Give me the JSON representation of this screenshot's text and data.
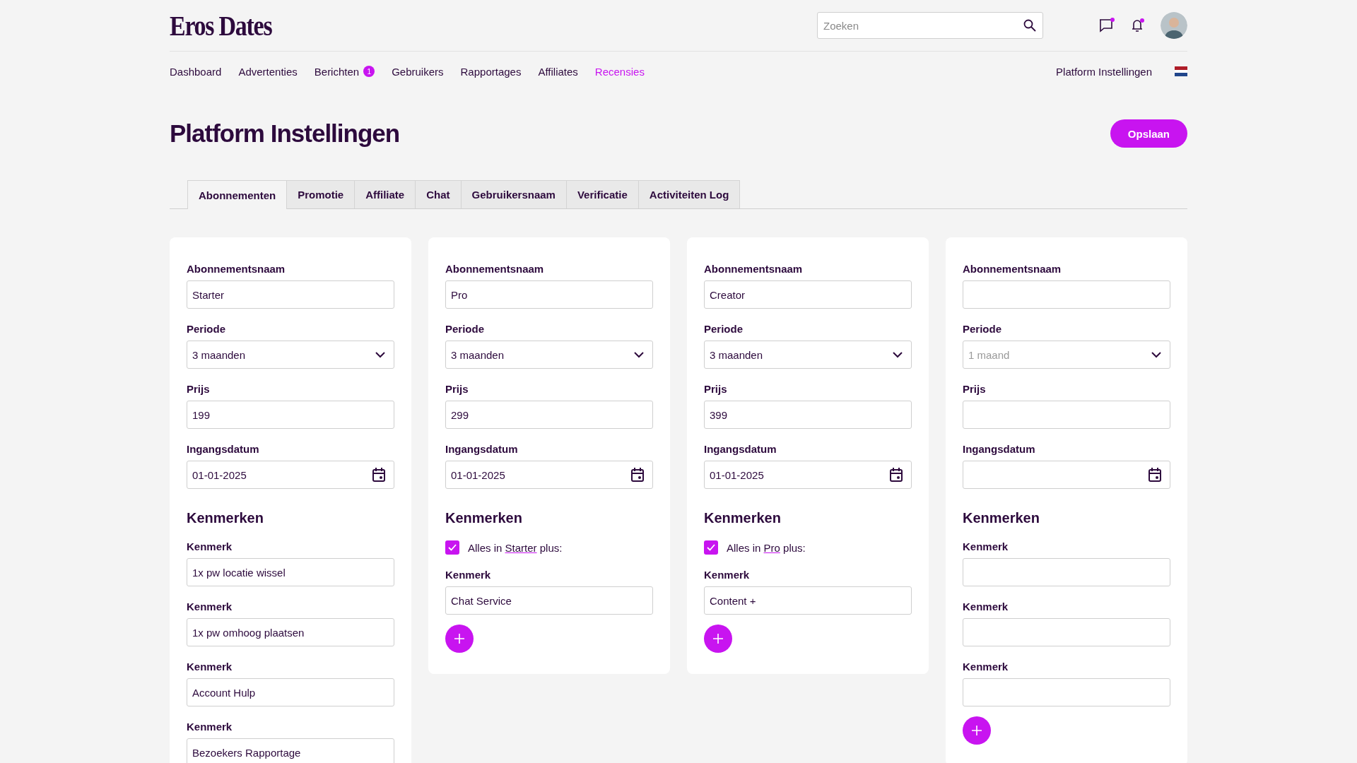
{
  "header": {
    "logo": "Eros Dates",
    "search": {
      "placeholder": "Zoeken"
    }
  },
  "nav": {
    "items": [
      {
        "label": "Dashboard",
        "selected": false
      },
      {
        "label": "Advertenties",
        "selected": false
      },
      {
        "label": "Berichten",
        "selected": false,
        "badge": "1"
      },
      {
        "label": "Gebruikers",
        "selected": false
      },
      {
        "label": "Rapportages",
        "selected": false
      },
      {
        "label": "Affiliates",
        "selected": false
      },
      {
        "label": "Recensies",
        "selected": true
      }
    ],
    "settings_link": "Platform Instellingen"
  },
  "page": {
    "title": "Platform Instellingen",
    "save_button": "Opslaan"
  },
  "tabs": [
    {
      "label": "Abonnementen",
      "selected": true
    },
    {
      "label": "Promotie",
      "selected": false
    },
    {
      "label": "Affiliate",
      "selected": false
    },
    {
      "label": "Chat",
      "selected": false
    },
    {
      "label": "Gebruikersnaam",
      "selected": false
    },
    {
      "label": "Verificatie",
      "selected": false
    },
    {
      "label": "Activiteiten Log",
      "selected": false
    }
  ],
  "plans": [
    {
      "name_label": "Abonnementsnaam",
      "name": "Starter",
      "period_label": "Periode",
      "period": {
        "value": "3 maanden"
      },
      "price_label": "Prijs",
      "price": "199",
      "date_label": "Ingangsdatum",
      "date": "01-01-2025",
      "features_heading": "Kenmerken",
      "features": [
        {
          "label": "Kenmerk",
          "value": "1x pw locatie wissel"
        },
        {
          "label": "Kenmerk",
          "value": "1x pw omhoog plaatsen"
        },
        {
          "label": "Kenmerk",
          "value": "Account Hulp"
        },
        {
          "label": "Kenmerk",
          "value": "Bezoekers Rapportage"
        }
      ]
    },
    {
      "name_label": "Abonnementsnaam",
      "name": "Pro",
      "period_label": "Periode",
      "period": {
        "value": "3 maanden"
      },
      "price_label": "Prijs",
      "price": "299",
      "date_label": "Ingangsdatum",
      "date": "01-01-2025",
      "features_heading": "Kenmerken",
      "inherit": {
        "checked": true,
        "prefix": "Alles in",
        "link": "Starter",
        "suffix": "plus:"
      },
      "features": [
        {
          "label": "Kenmerk",
          "value": "Chat Service"
        }
      ],
      "add_button": true
    },
    {
      "name_label": "Abonnementsnaam",
      "name": "Creator",
      "period_label": "Periode",
      "period": {
        "value": "3 maanden"
      },
      "price_label": "Prijs",
      "price": "399",
      "date_label": "Ingangsdatum",
      "date": "01-01-2025",
      "features_heading": "Kenmerken",
      "inherit": {
        "checked": true,
        "prefix": "Alles in",
        "link": "Pro",
        "suffix": "plus:"
      },
      "features": [
        {
          "label": "Kenmerk",
          "value": "Content +"
        }
      ],
      "add_button": true
    },
    {
      "name_label": "Abonnementsnaam",
      "period_label": "Periode",
      "period": {
        "placeholder": "1 maand"
      },
      "price_label": "Prijs",
      "date_label": "Ingangsdatum",
      "features_heading": "Kenmerken",
      "features": [
        {
          "label": "Kenmerk"
        },
        {
          "label": "Kenmerk"
        },
        {
          "label": "Kenmerk"
        }
      ],
      "add_button": true
    }
  ]
}
